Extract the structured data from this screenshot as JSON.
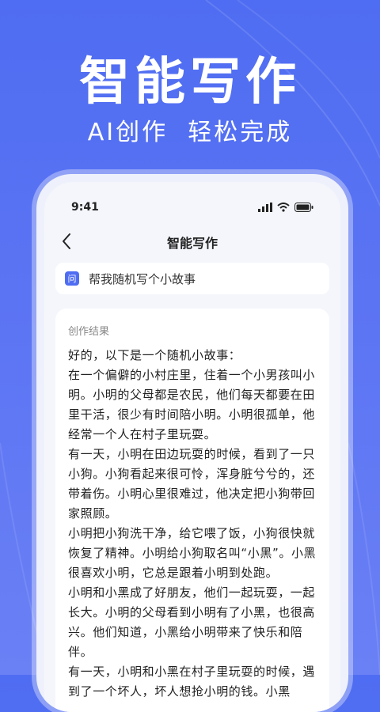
{
  "banner": {
    "title": "智能写作",
    "subtitle": "AI创作  轻松完成"
  },
  "status_bar": {
    "time": "9:41"
  },
  "nav": {
    "title": "智能写作"
  },
  "question": {
    "badge": "问",
    "text": "帮我随机写个小故事"
  },
  "result": {
    "label": "创作结果",
    "paragraphs": [
      "好的，以下是一个随机小故事：",
      "在一个偏僻的小村庄里，住着一个小男孩叫小明。小明的父母都是农民，他们每天都要在田里干活，很少有时间陪小明。小明很孤单，他经常一个人在村子里玩耍。",
      "有一天，小明在田边玩耍的时候，看到了一只小狗。小狗看起来很可怜，浑身脏兮兮的，还带着伤。小明心里很难过，他决定把小狗带回家照顾。",
      "小明把小狗洗干净，给它喂了饭，小狗很快就恢复了精神。小明给小狗取名叫“小黑”。小黑很喜欢小明，它总是跟着小明到处跑。",
      "小明和小黑成了好朋友，他们一起玩耍，一起长大。小明的父母看到小明有了小黑，也很高兴。他们知道，小黑给小明带来了快乐和陪伴。",
      "有一天，小明和小黑在村子里玩耍的时候，遇到了一个坏人，坏人想抢小明的钱。小黑"
    ]
  },
  "colors": {
    "background": "#5670f3",
    "accent": "#4f6df2"
  }
}
